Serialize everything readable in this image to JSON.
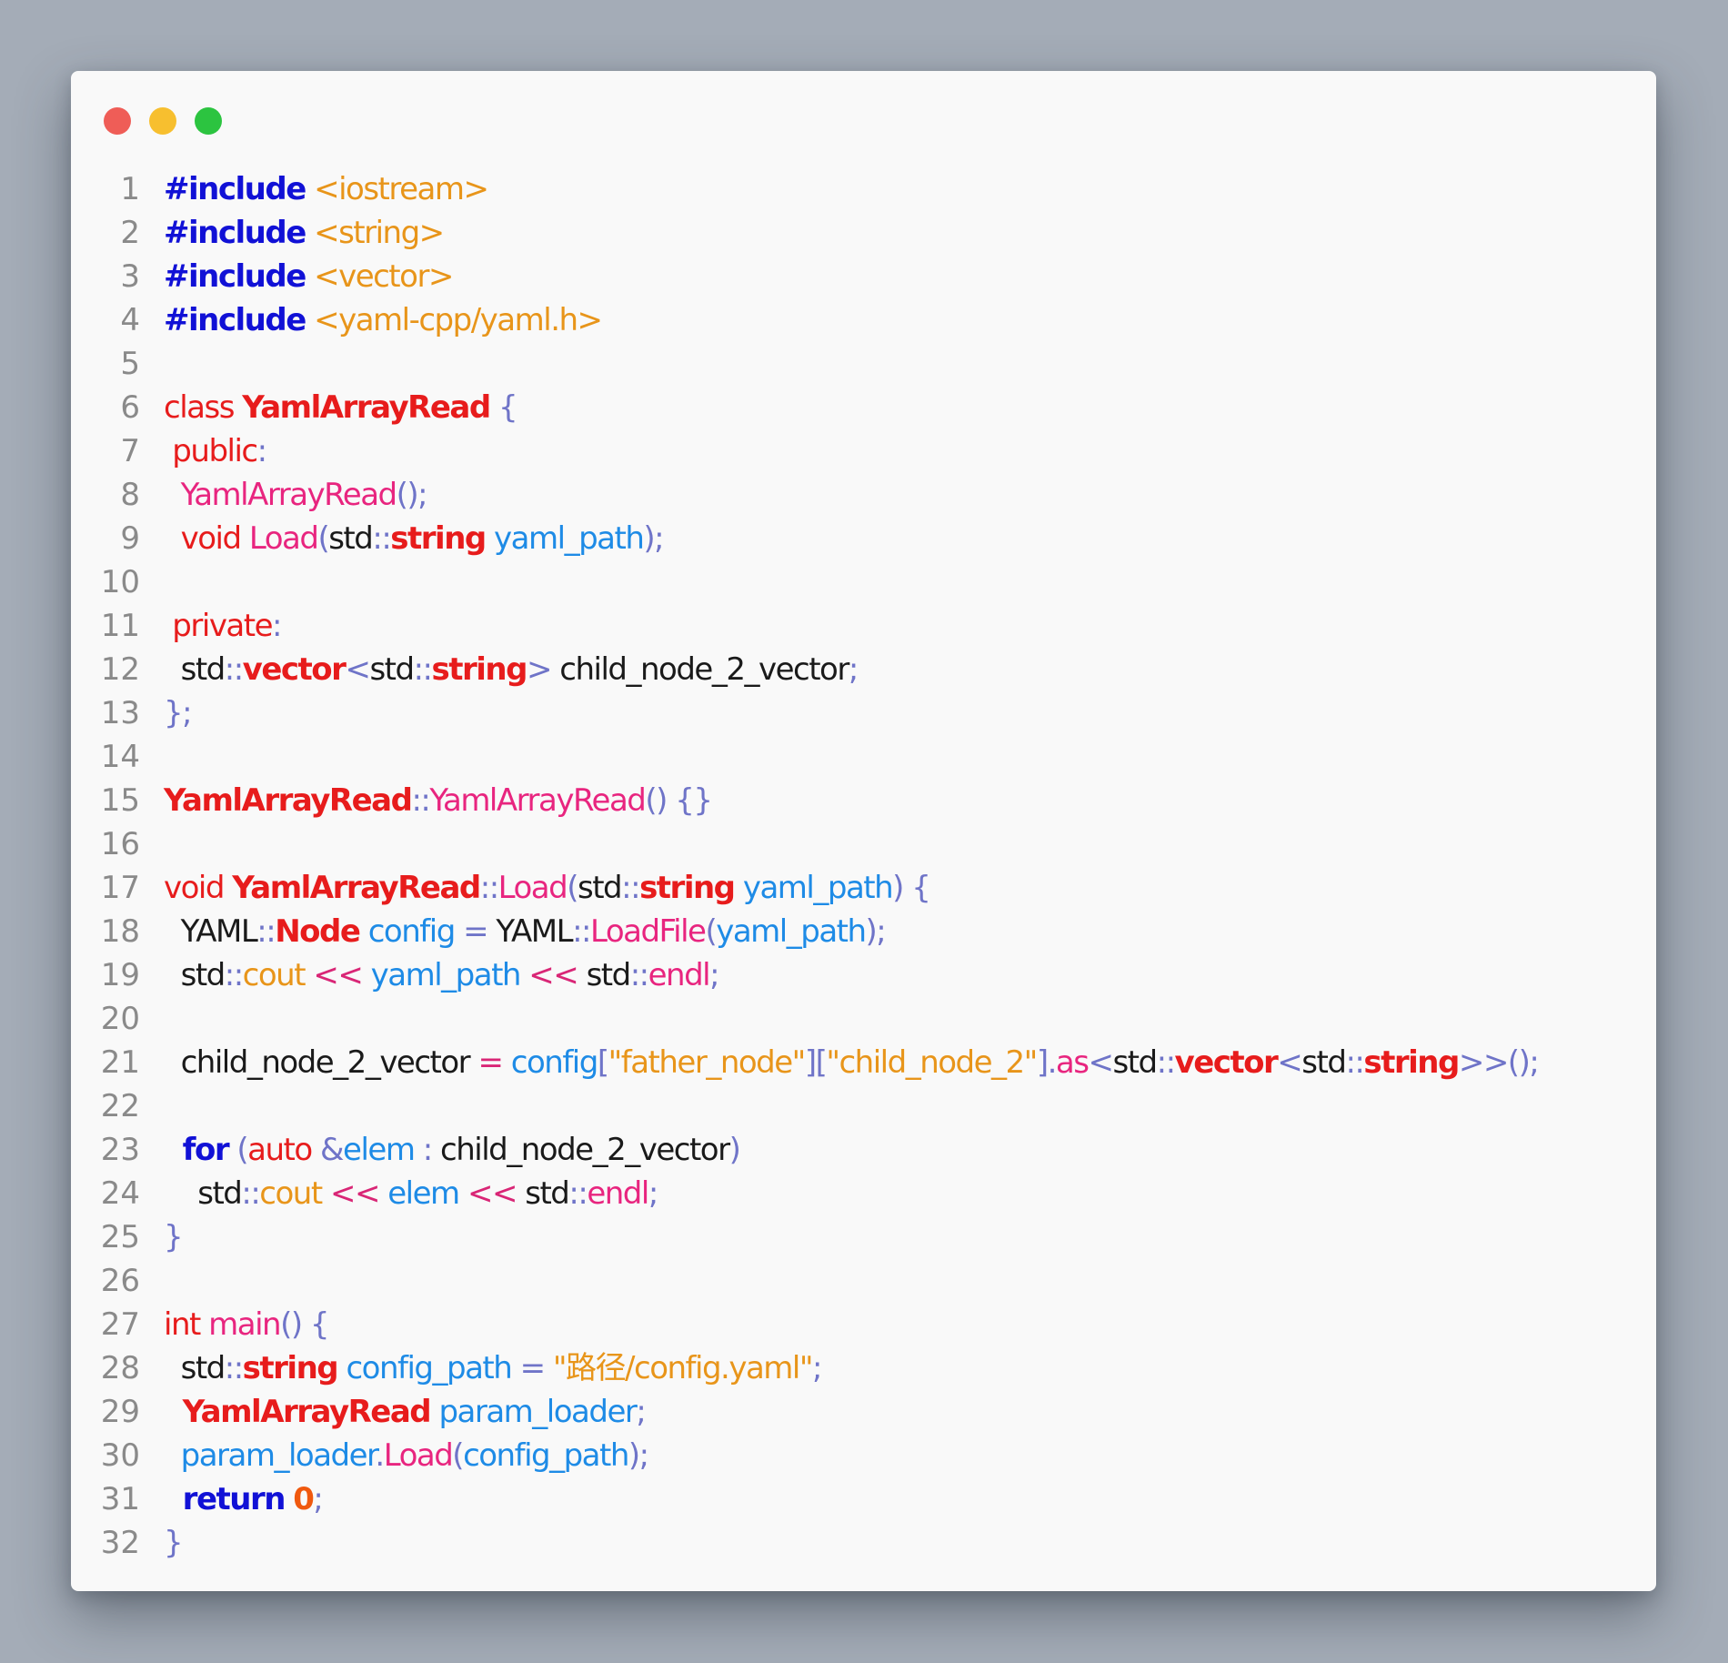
{
  "window": {
    "traffic_lights": {
      "close_color": "#ef5d57",
      "minimize_color": "#f7bf2f",
      "zoom_color": "#2cc440"
    }
  },
  "code_lines": [
    {
      "n": "1",
      "tokens": [
        [
          "#",
          "dir"
        ],
        [
          "include",
          "dir"
        ],
        [
          " <iostream>",
          "hdr"
        ]
      ]
    },
    {
      "n": "2",
      "tokens": [
        [
          "#",
          "dir"
        ],
        [
          "include",
          "dir"
        ],
        [
          " <string>",
          "hdr"
        ]
      ]
    },
    {
      "n": "3",
      "tokens": [
        [
          "#",
          "dir"
        ],
        [
          "include",
          "dir"
        ],
        [
          " <vector>",
          "hdr"
        ]
      ]
    },
    {
      "n": "4",
      "tokens": [
        [
          "#",
          "dir"
        ],
        [
          "include",
          "dir"
        ],
        [
          " <yaml-cpp/yaml.h>",
          "hdr"
        ]
      ]
    },
    {
      "n": "5",
      "tokens": []
    },
    {
      "n": "6",
      "tokens": [
        [
          "class ",
          "kw"
        ],
        [
          "YamlArrayRead",
          "cls"
        ],
        [
          " {",
          "pun"
        ]
      ]
    },
    {
      "n": "7",
      "tokens": [
        [
          " public",
          "kw"
        ],
        [
          ":",
          "pun"
        ]
      ]
    },
    {
      "n": "8",
      "tokens": [
        [
          "  YamlArrayRead",
          "fn"
        ],
        [
          "();",
          "pun"
        ]
      ]
    },
    {
      "n": "9",
      "tokens": [
        [
          "  void ",
          "kw"
        ],
        [
          "Load",
          "fn"
        ],
        [
          "(",
          "pun"
        ],
        [
          "std",
          "plain"
        ],
        [
          "::",
          "pun"
        ],
        [
          "string",
          "typ"
        ],
        [
          " yaml_path",
          "var"
        ],
        [
          ");",
          "pun"
        ]
      ]
    },
    {
      "n": "10",
      "tokens": []
    },
    {
      "n": "11",
      "tokens": [
        [
          " private",
          "kw"
        ],
        [
          ":",
          "pun"
        ]
      ]
    },
    {
      "n": "12",
      "tokens": [
        [
          "  std",
          "plain"
        ],
        [
          "::",
          "pun"
        ],
        [
          "vector",
          "typ"
        ],
        [
          "<",
          "pun"
        ],
        [
          "std",
          "plain"
        ],
        [
          "::",
          "pun"
        ],
        [
          "string",
          "typ"
        ],
        [
          "> ",
          "pun"
        ],
        [
          "child_node_2_vector",
          "plain"
        ],
        [
          ";",
          "pun"
        ]
      ]
    },
    {
      "n": "13",
      "tokens": [
        [
          "};",
          "pun"
        ]
      ]
    },
    {
      "n": "14",
      "tokens": []
    },
    {
      "n": "15",
      "tokens": [
        [
          "YamlArrayRead",
          "cls"
        ],
        [
          "::",
          "pun"
        ],
        [
          "YamlArrayRead",
          "fn"
        ],
        [
          "() {}",
          "pun"
        ]
      ]
    },
    {
      "n": "16",
      "tokens": []
    },
    {
      "n": "17",
      "tokens": [
        [
          "void ",
          "kw"
        ],
        [
          "YamlArrayRead",
          "cls"
        ],
        [
          "::",
          "pun"
        ],
        [
          "Load",
          "fn"
        ],
        [
          "(",
          "pun"
        ],
        [
          "std",
          "plain"
        ],
        [
          "::",
          "pun"
        ],
        [
          "string",
          "typ"
        ],
        [
          " yaml_path",
          "var"
        ],
        [
          ") {",
          "pun"
        ]
      ]
    },
    {
      "n": "18",
      "tokens": [
        [
          "  YAML",
          "plain"
        ],
        [
          "::",
          "pun"
        ],
        [
          "Node",
          "typ"
        ],
        [
          " config",
          "var"
        ],
        [
          " = ",
          "pun"
        ],
        [
          "YAML",
          "plain"
        ],
        [
          "::",
          "pun"
        ],
        [
          "LoadFile",
          "fn"
        ],
        [
          "(",
          "pun"
        ],
        [
          "yaml_path",
          "var"
        ],
        [
          ");",
          "pun"
        ]
      ]
    },
    {
      "n": "19",
      "tokens": [
        [
          "  std",
          "plain"
        ],
        [
          "::",
          "pun"
        ],
        [
          "cout",
          "hdr"
        ],
        [
          " << ",
          "op"
        ],
        [
          "yaml_path",
          "var"
        ],
        [
          " << ",
          "op"
        ],
        [
          "std",
          "plain"
        ],
        [
          "::",
          "pun"
        ],
        [
          "endl",
          "fn"
        ],
        [
          ";",
          "pun"
        ]
      ]
    },
    {
      "n": "20",
      "tokens": []
    },
    {
      "n": "21",
      "tokens": [
        [
          "  child_node_2_vector",
          "plain"
        ],
        [
          " = ",
          "op"
        ],
        [
          "config",
          "var"
        ],
        [
          "[",
          "pun"
        ],
        [
          "\"father_node\"",
          "str"
        ],
        [
          "][",
          "pun"
        ],
        [
          "\"child_node_2\"",
          "str"
        ],
        [
          "].",
          "pun"
        ],
        [
          "as",
          "fn"
        ],
        [
          "<",
          "pun"
        ],
        [
          "std",
          "plain"
        ],
        [
          "::",
          "pun"
        ],
        [
          "vector",
          "typ"
        ],
        [
          "<",
          "pun"
        ],
        [
          "std",
          "plain"
        ],
        [
          "::",
          "pun"
        ],
        [
          "string",
          "typ"
        ],
        [
          ">>();",
          "pun"
        ]
      ]
    },
    {
      "n": "22",
      "tokens": []
    },
    {
      "n": "23",
      "tokens": [
        [
          "  for",
          "kwb"
        ],
        [
          " (",
          "pun"
        ],
        [
          "auto",
          "kw"
        ],
        [
          " &",
          "pun"
        ],
        [
          "elem",
          "var"
        ],
        [
          " : ",
          "pun"
        ],
        [
          "child_node_2_vector",
          "plain"
        ],
        [
          ")",
          "pun"
        ]
      ]
    },
    {
      "n": "24",
      "tokens": [
        [
          "    std",
          "plain"
        ],
        [
          "::",
          "pun"
        ],
        [
          "cout",
          "hdr"
        ],
        [
          " << ",
          "op"
        ],
        [
          "elem",
          "var"
        ],
        [
          " << ",
          "op"
        ],
        [
          "std",
          "plain"
        ],
        [
          "::",
          "pun"
        ],
        [
          "endl",
          "fn"
        ],
        [
          ";",
          "pun"
        ]
      ]
    },
    {
      "n": "25",
      "tokens": [
        [
          "}",
          "pun"
        ]
      ]
    },
    {
      "n": "26",
      "tokens": []
    },
    {
      "n": "27",
      "tokens": [
        [
          "int ",
          "kw"
        ],
        [
          "main",
          "fn"
        ],
        [
          "() {",
          "pun"
        ]
      ]
    },
    {
      "n": "28",
      "tokens": [
        [
          "  std",
          "plain"
        ],
        [
          "::",
          "pun"
        ],
        [
          "string",
          "typ"
        ],
        [
          " config_path",
          "var"
        ],
        [
          " = ",
          "pun"
        ],
        [
          "\"路径/config.yaml\"",
          "str"
        ],
        [
          ";",
          "pun"
        ]
      ]
    },
    {
      "n": "29",
      "tokens": [
        [
          "  YamlArrayRead",
          "cls"
        ],
        [
          " param_loader",
          "var"
        ],
        [
          ";",
          "pun"
        ]
      ]
    },
    {
      "n": "30",
      "tokens": [
        [
          "  param_loader",
          "var"
        ],
        [
          ".",
          "pun"
        ],
        [
          "Load",
          "fn"
        ],
        [
          "(",
          "pun"
        ],
        [
          "config_path",
          "var"
        ],
        [
          ");",
          "pun"
        ]
      ]
    },
    {
      "n": "31",
      "tokens": [
        [
          "  return",
          "kwb"
        ],
        [
          " ",
          "pun"
        ],
        [
          "0",
          "num"
        ],
        [
          ";",
          "pun"
        ]
      ]
    },
    {
      "n": "32",
      "tokens": [
        [
          "}",
          "pun"
        ]
      ]
    }
  ]
}
